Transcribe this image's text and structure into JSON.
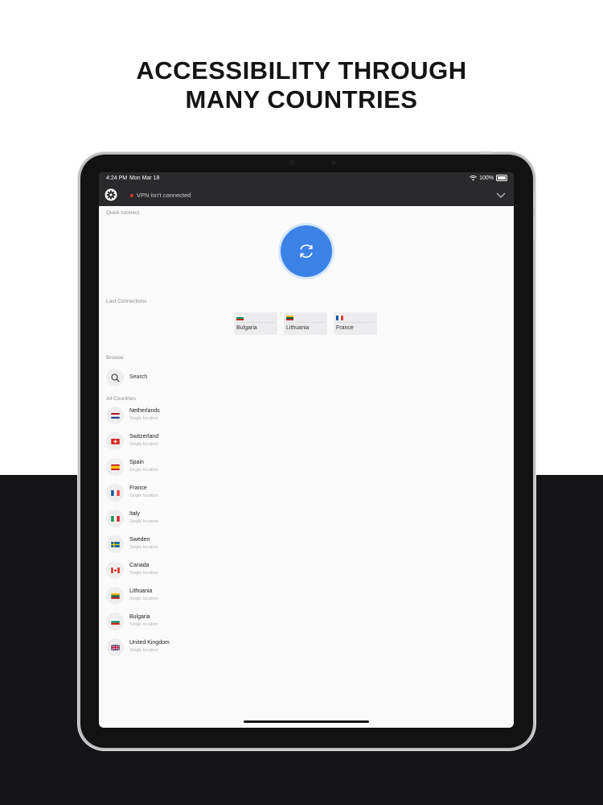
{
  "headline": {
    "line1": "ACCESSIBILITY THROUGH",
    "line2": "MANY COUNTRIES"
  },
  "status_bar": {
    "time": "4:24 PM",
    "date": "Mon Mar 18",
    "battery": "100%"
  },
  "top_bar": {
    "vpn_status": "VPN isn't connected",
    "icons": [
      "gear-icon",
      "chevron-down-icon"
    ]
  },
  "quick_connect": {
    "label": "Quick connect",
    "icon": "refresh-icon",
    "accent": "#3b82e6"
  },
  "last_connections": {
    "label": "Last Connections",
    "items": [
      {
        "name": "Bulgaria",
        "flag": "bulgaria"
      },
      {
        "name": "Lithuania",
        "flag": "lithuania"
      },
      {
        "name": "France",
        "flag": "france"
      }
    ]
  },
  "browse": {
    "label": "Browse",
    "search_label": "Search"
  },
  "all_countries": {
    "label": "All Countries",
    "items": [
      {
        "name": "Netherlands",
        "sub": "Single location",
        "flag": "netherlands"
      },
      {
        "name": "Switzerland",
        "sub": "Single location",
        "flag": "switzerland"
      },
      {
        "name": "Spain",
        "sub": "Single location",
        "flag": "spain"
      },
      {
        "name": "France",
        "sub": "Single location",
        "flag": "france"
      },
      {
        "name": "Italy",
        "sub": "Single location",
        "flag": "italy"
      },
      {
        "name": "Sweden",
        "sub": "Single location",
        "flag": "sweden"
      },
      {
        "name": "Canada",
        "sub": "Single location",
        "flag": "canada"
      },
      {
        "name": "Lithuania",
        "sub": "Single location",
        "flag": "lithuania"
      },
      {
        "name": "Bulgaria",
        "sub": "Single location",
        "flag": "bulgaria"
      },
      {
        "name": "United Kingdom",
        "sub": "Single location",
        "flag": "united-kingdom"
      }
    ]
  }
}
